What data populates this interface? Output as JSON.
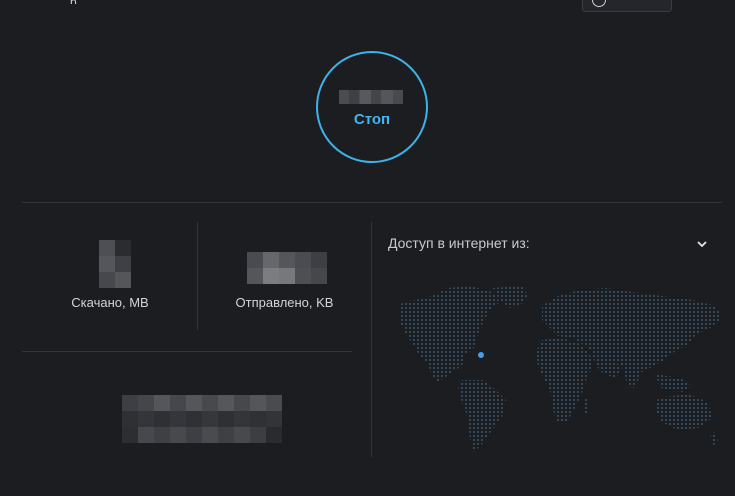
{
  "header": {
    "partial_text": "р"
  },
  "vpn": {
    "action_label": "Стоп"
  },
  "stats": {
    "downloaded_label": "Скачано, MB",
    "uploaded_label": "Отправлено, KB"
  },
  "access": {
    "title": "Доступ в интернет из:"
  },
  "colors": {
    "accent": "#3eb1e6",
    "background": "#1c1d21",
    "divider": "#34353a",
    "map_dot": "#3a5870",
    "location_dot": "#3ea0f0"
  },
  "icons": {
    "expand": "chevron-down-icon",
    "map": "world-map",
    "location": "location-dot-icon"
  }
}
